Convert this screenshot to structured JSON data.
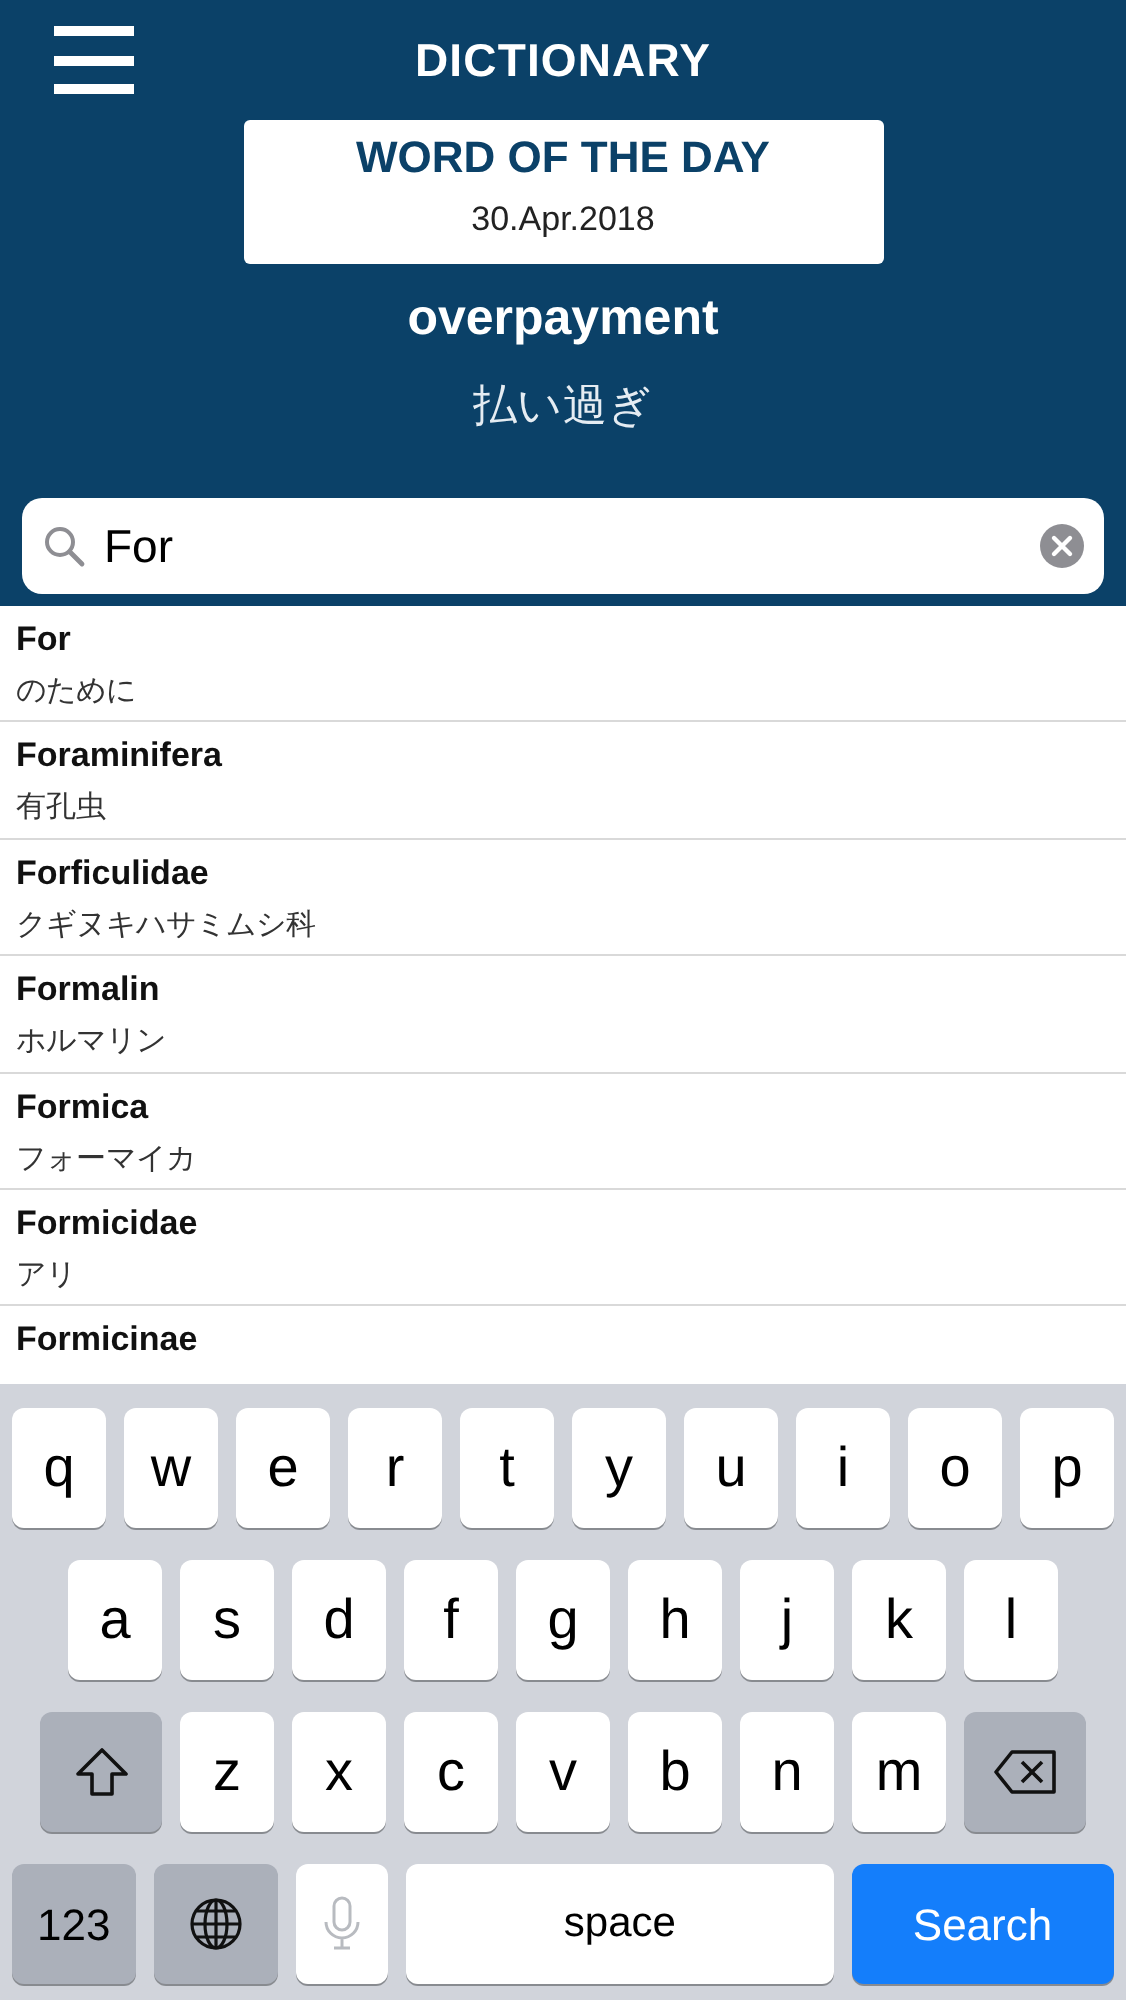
{
  "header": {
    "title": "DICTIONARY"
  },
  "word_of_the_day": {
    "heading": "WORD OF THE DAY",
    "date": "30.Apr.2018",
    "word": "overpayment",
    "translation": "払い過ぎ"
  },
  "search": {
    "value": "For"
  },
  "results": [
    {
      "word": "For",
      "translation": "のために"
    },
    {
      "word": "Foraminifera",
      "translation": "有孔虫"
    },
    {
      "word": "Forficulidae",
      "translation": "クギヌキハサミムシ科"
    },
    {
      "word": "Formalin",
      "translation": "ホルマリン"
    },
    {
      "word": "Formica",
      "translation": "フォーマイカ"
    },
    {
      "word": "Formicidae",
      "translation": "アリ"
    },
    {
      "word": "Formicinae"
    }
  ],
  "keyboard": {
    "rows": [
      {
        "keys": [
          {
            "kind": "letter",
            "label": "q"
          },
          {
            "kind": "letter",
            "label": "w"
          },
          {
            "kind": "letter",
            "label": "e"
          },
          {
            "kind": "letter",
            "label": "r"
          },
          {
            "kind": "letter",
            "label": "t"
          },
          {
            "kind": "letter",
            "label": "y"
          },
          {
            "kind": "letter",
            "label": "u"
          },
          {
            "kind": "letter",
            "label": "i"
          },
          {
            "kind": "letter",
            "label": "o"
          },
          {
            "kind": "letter",
            "label": "p"
          }
        ]
      },
      {
        "keys": [
          {
            "kind": "letter",
            "label": "a"
          },
          {
            "kind": "letter",
            "label": "s"
          },
          {
            "kind": "letter",
            "label": "d"
          },
          {
            "kind": "letter",
            "label": "f"
          },
          {
            "kind": "letter",
            "label": "g"
          },
          {
            "kind": "letter",
            "label": "h"
          },
          {
            "kind": "letter",
            "label": "j"
          },
          {
            "kind": "letter",
            "label": "k"
          },
          {
            "kind": "letter",
            "label": "l"
          }
        ]
      },
      {
        "keys": [
          {
            "kind": "shift"
          },
          {
            "kind": "letter",
            "label": "z"
          },
          {
            "kind": "letter",
            "label": "x"
          },
          {
            "kind": "letter",
            "label": "c"
          },
          {
            "kind": "letter",
            "label": "v"
          },
          {
            "kind": "letter",
            "label": "b"
          },
          {
            "kind": "letter",
            "label": "n"
          },
          {
            "kind": "letter",
            "label": "m"
          },
          {
            "kind": "backspace"
          }
        ]
      },
      {
        "keys": [
          {
            "kind": "mode",
            "label": "123"
          },
          {
            "kind": "globe"
          },
          {
            "kind": "mic",
            "disabled": true
          },
          {
            "kind": "space",
            "label": "space"
          },
          {
            "kind": "action",
            "label": "Search"
          }
        ]
      }
    ]
  }
}
